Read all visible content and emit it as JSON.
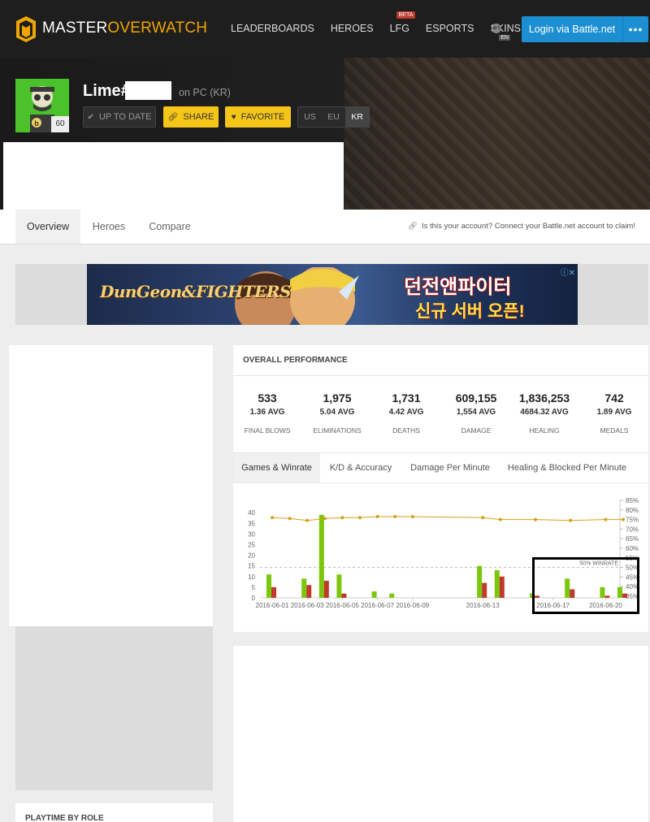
{
  "nav": {
    "brand_pre": "MASTER",
    "brand_post": "OVERWATCH",
    "links": [
      "LEADERBOARDS",
      "HEROES",
      "LFG",
      "ESPORTS",
      "SKINS"
    ],
    "beta_label": "BETA",
    "lang": "EN",
    "login_label": "Login via Battle.net",
    "more_label": "•••"
  },
  "profile": {
    "name": "Lime#",
    "platform": "on PC (KR)",
    "level": "60",
    "buttons": {
      "up_to_date": "UP TO DATE",
      "share": "SHARE",
      "favorite": "FAVORITE"
    },
    "regions": [
      "US",
      "EU",
      "KR"
    ],
    "active_region": "KR"
  },
  "tabs": [
    "Overview",
    "Heroes",
    "Compare"
  ],
  "claim_text": "Is this your account? Connect your Battle.net account to claim!",
  "ad": {
    "title": "DunGeon&FIGHTERS",
    "ko_line1": "던전앤파이터",
    "ko_line2": "신규 서버 오픈!",
    "close": "ⓘ✕"
  },
  "performance": {
    "title": "OVERALL PERFORMANCE",
    "stats": [
      {
        "value": "533",
        "avg": "1.36 AVG",
        "label": "FINAL BLOWS"
      },
      {
        "value": "1,975",
        "avg": "5.04 AVG",
        "label": "ELIMINATIONS"
      },
      {
        "value": "1,731",
        "avg": "4.42 AVG",
        "label": "DEATHS"
      },
      {
        "value": "609,155",
        "avg": "1,554 AVG",
        "label": "DAMAGE"
      },
      {
        "value": "1,836,253",
        "avg": "4684.32 AVG",
        "label": "HEALING"
      },
      {
        "value": "742",
        "avg": "1.89 AVG",
        "label": "MEDALS"
      }
    ],
    "subtabs": [
      "Games & Winrate",
      "K/D & Accuracy",
      "Damage Per Minute",
      "Healing & Blocked Per Minute"
    ]
  },
  "left_card_title": "PLAYTIME BY ROLE",
  "chart_data": {
    "type": "bar",
    "x_tick_labels": [
      "2016-06-01",
      "2016-06-03",
      "2016-06-05",
      "2016-06-07",
      "2016-06-09",
      "2016-06-13",
      "2016-06-17",
      "2016-06-20"
    ],
    "y_left_ticks": [
      0,
      5,
      10,
      15,
      20,
      25,
      30,
      35,
      40
    ],
    "y_right_ticks": [
      "35%",
      "40%",
      "45%",
      "50%",
      "55%",
      "60%",
      "65%",
      "70%",
      "75%",
      "80%",
      "85%"
    ],
    "ylim": [
      0,
      42
    ],
    "ylim_right": [
      35,
      85
    ],
    "winrate_reference": {
      "value": 50,
      "label": "50% WINRATE"
    },
    "series": [
      {
        "name": "wins",
        "color": "#7ac70c",
        "points": [
          {
            "day": 1,
            "value": 11
          },
          {
            "day": 3,
            "value": 9
          },
          {
            "day": 4,
            "value": 39
          },
          {
            "day": 5,
            "value": 11
          },
          {
            "day": 7,
            "value": 3
          },
          {
            "day": 8,
            "value": 2
          },
          {
            "day": 13,
            "value": 15
          },
          {
            "day": 14,
            "value": 13
          },
          {
            "day": 16,
            "value": 2
          },
          {
            "day": 18,
            "value": 9
          },
          {
            "day": 20,
            "value": 5
          },
          {
            "day": 21,
            "value": 5
          }
        ]
      },
      {
        "name": "losses",
        "color": "#c0392b",
        "points": [
          {
            "day": 1,
            "value": 5
          },
          {
            "day": 3,
            "value": 6
          },
          {
            "day": 4,
            "value": 8
          },
          {
            "day": 5,
            "value": 2
          },
          {
            "day": 13,
            "value": 7
          },
          {
            "day": 14,
            "value": 10
          },
          {
            "day": 16,
            "value": 1
          },
          {
            "day": 18,
            "value": 4
          },
          {
            "day": 20,
            "value": 1
          },
          {
            "day": 21,
            "value": 2
          }
        ]
      },
      {
        "name": "winrate",
        "color": "#d4a017",
        "axis": "right",
        "points": [
          {
            "day": 1,
            "value": 76
          },
          {
            "day": 2,
            "value": 75.5
          },
          {
            "day": 3,
            "value": 74.5
          },
          {
            "day": 4,
            "value": 75.5
          },
          {
            "day": 5,
            "value": 76
          },
          {
            "day": 6,
            "value": 76
          },
          {
            "day": 7,
            "value": 76.5
          },
          {
            "day": 8,
            "value": 76.5
          },
          {
            "day": 9,
            "value": 76.5
          },
          {
            "day": 13,
            "value": 76
          },
          {
            "day": 14,
            "value": 75
          },
          {
            "day": 16,
            "value": 75
          },
          {
            "day": 18,
            "value": 74.5
          },
          {
            "day": 20,
            "value": 75
          },
          {
            "day": 21,
            "value": 75
          }
        ]
      }
    ]
  }
}
